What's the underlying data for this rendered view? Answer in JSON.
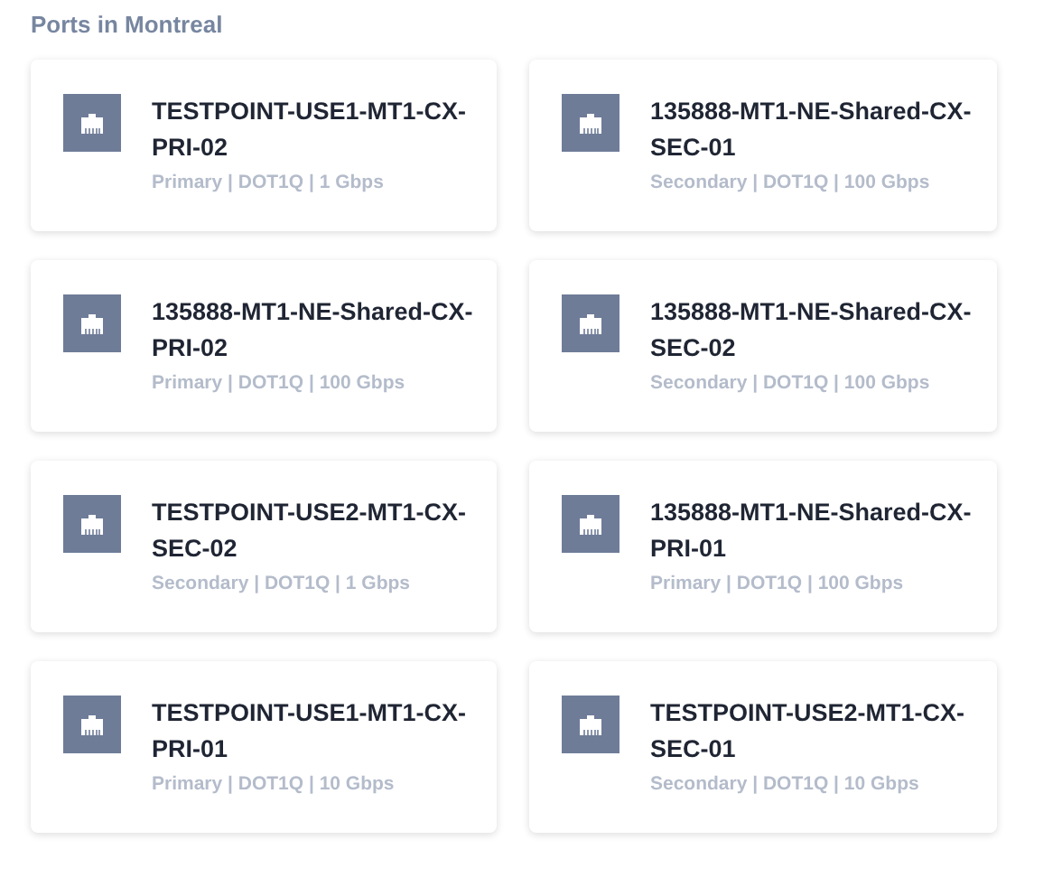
{
  "heading": "Ports in Montreal",
  "ports": [
    {
      "name": "TESTPOINT-USE1-MT1-CX-PRI-02",
      "details": "Primary | DOT1Q | 1 Gbps"
    },
    {
      "name": "135888-MT1-NE-Shared-CX-SEC-01",
      "details": "Secondary | DOT1Q | 100 Gbps"
    },
    {
      "name": "135888-MT1-NE-Shared-CX-PRI-02",
      "details": "Primary | DOT1Q | 100 Gbps"
    },
    {
      "name": "135888-MT1-NE-Shared-CX-SEC-02",
      "details": "Secondary | DOT1Q | 100 Gbps"
    },
    {
      "name": "TESTPOINT-USE2-MT1-CX-SEC-02",
      "details": "Secondary | DOT1Q | 1 Gbps"
    },
    {
      "name": "135888-MT1-NE-Shared-CX-PRI-01",
      "details": "Primary | DOT1Q | 100 Gbps"
    },
    {
      "name": "TESTPOINT-USE1-MT1-CX-PRI-01",
      "details": "Primary | DOT1Q | 10 Gbps"
    },
    {
      "name": "TESTPOINT-USE2-MT1-CX-SEC-01",
      "details": "Secondary | DOT1Q | 10 Gbps"
    }
  ]
}
